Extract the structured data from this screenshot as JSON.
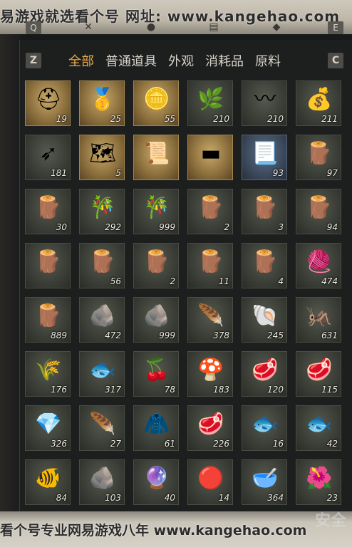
{
  "header": {
    "banner": "易游戏就选看个号   网址: www.kangehao.com",
    "keys_top": [
      "Q",
      "E"
    ],
    "icons_top": [
      "✕",
      "●",
      "▤",
      "◆"
    ]
  },
  "filters": {
    "prev_key": "Z",
    "next_key": "C",
    "tabs": [
      {
        "label": "全部",
        "active": true
      },
      {
        "label": "普通道具",
        "active": false
      },
      {
        "label": "外观",
        "active": false
      },
      {
        "label": "消耗品",
        "active": false
      },
      {
        "label": "原料",
        "active": false
      }
    ]
  },
  "items": [
    {
      "icon": "bronze-helmet-icon",
      "glyph": "⛑",
      "qty": "19",
      "style": "gold"
    },
    {
      "icon": "gold-ingot-icon",
      "glyph": "🥇",
      "qty": "25",
      "style": "gold"
    },
    {
      "icon": "cat-coin-icon",
      "glyph": "🪙",
      "qty": "55",
      "style": "gold"
    },
    {
      "icon": "herb-powder-icon",
      "glyph": "🌿",
      "qty": "210",
      "style": ""
    },
    {
      "icon": "worm-icon",
      "glyph": "〰",
      "qty": "210",
      "style": ""
    },
    {
      "icon": "cloth-sack-icon",
      "glyph": "💰",
      "qty": "211",
      "style": ""
    },
    {
      "icon": "arrows-icon",
      "glyph": "➶",
      "qty": "181",
      "style": ""
    },
    {
      "icon": "map-fragment-icon",
      "glyph": "🗺",
      "qty": "5",
      "style": "gold"
    },
    {
      "icon": "scroll-icon",
      "glyph": "📜",
      "qty": "",
      "style": "gold"
    },
    {
      "icon": "gold-bar-icon",
      "glyph": "▬",
      "qty": "",
      "style": "gold"
    },
    {
      "icon": "parchment-icon",
      "glyph": "📃",
      "qty": "93",
      "style": "blue"
    },
    {
      "icon": "log-bundle-icon",
      "glyph": "🪵",
      "qty": "97",
      "style": ""
    },
    {
      "icon": "log-bundle-icon",
      "glyph": "🪵",
      "qty": "30",
      "style": ""
    },
    {
      "icon": "bamboo-bundle-icon",
      "glyph": "🎋",
      "qty": "292",
      "style": ""
    },
    {
      "icon": "bamboo-bundle-icon",
      "glyph": "🎋",
      "qty": "999",
      "style": ""
    },
    {
      "icon": "log-bundle-icon",
      "glyph": "🪵",
      "qty": "2",
      "style": ""
    },
    {
      "icon": "log-bundle-icon",
      "glyph": "🪵",
      "qty": "3",
      "style": ""
    },
    {
      "icon": "log-bundle-icon",
      "glyph": "🪵",
      "qty": "94",
      "style": ""
    },
    {
      "icon": "log-bundle-icon",
      "glyph": "🪵",
      "qty": "",
      "style": ""
    },
    {
      "icon": "log-bundle-icon",
      "glyph": "🪵",
      "qty": "56",
      "style": ""
    },
    {
      "icon": "log-bundle-icon",
      "glyph": "🪵",
      "qty": "2",
      "style": ""
    },
    {
      "icon": "log-bundle-icon",
      "glyph": "🪵",
      "qty": "11",
      "style": ""
    },
    {
      "icon": "log-bundle-icon",
      "glyph": "🪵",
      "qty": "4",
      "style": ""
    },
    {
      "icon": "fiber-bundle-icon",
      "glyph": "🧶",
      "qty": "474",
      "style": ""
    },
    {
      "icon": "log-bundle-icon",
      "glyph": "🪵",
      "qty": "889",
      "style": ""
    },
    {
      "icon": "rock-icon",
      "glyph": "🪨",
      "qty": "472",
      "style": ""
    },
    {
      "icon": "rock-icon",
      "glyph": "🪨",
      "qty": "999",
      "style": ""
    },
    {
      "icon": "feather-icon",
      "glyph": "🪶",
      "qty": "378",
      "style": ""
    },
    {
      "icon": "shells-icon",
      "glyph": "🐚",
      "qty": "245",
      "style": ""
    },
    {
      "icon": "insect-icon",
      "glyph": "🦗",
      "qty": "631",
      "style": ""
    },
    {
      "icon": "grain-sack-icon",
      "glyph": "🌾",
      "qty": "176",
      "style": ""
    },
    {
      "icon": "fish-icon",
      "glyph": "🐟",
      "qty": "317",
      "style": ""
    },
    {
      "icon": "berries-icon",
      "glyph": "🍒",
      "qty": "78",
      "style": ""
    },
    {
      "icon": "mushroom-icon",
      "glyph": "🍄",
      "qty": "183",
      "style": ""
    },
    {
      "icon": "meat-chunks-icon",
      "glyph": "🥩",
      "qty": "120",
      "style": ""
    },
    {
      "icon": "meat-slab-icon",
      "glyph": "🥩",
      "qty": "115",
      "style": ""
    },
    {
      "icon": "jade-stone-icon",
      "glyph": "💎",
      "qty": "326",
      "style": ""
    },
    {
      "icon": "feathers-icon",
      "glyph": "🪶",
      "qty": "27",
      "style": ""
    },
    {
      "icon": "fur-pelt-icon",
      "glyph": "🧥",
      "qty": "61",
      "style": ""
    },
    {
      "icon": "red-meat-icon",
      "glyph": "🥩",
      "qty": "226",
      "style": ""
    },
    {
      "icon": "carp-fish-icon",
      "glyph": "🐟",
      "qty": "16",
      "style": ""
    },
    {
      "icon": "salmon-fish-icon",
      "glyph": "🐟",
      "qty": "42",
      "style": ""
    },
    {
      "icon": "golden-fish-icon",
      "glyph": "🐠",
      "qty": "84",
      "style": ""
    },
    {
      "icon": "ore-icon",
      "glyph": "🪨",
      "qty": "103",
      "style": ""
    },
    {
      "icon": "amethyst-icon",
      "glyph": "🔮",
      "qty": "40",
      "style": ""
    },
    {
      "icon": "red-gem-icon",
      "glyph": "🔴",
      "qty": "14",
      "style": ""
    },
    {
      "icon": "spice-bowl-icon",
      "glyph": "🥣",
      "qty": "364",
      "style": ""
    },
    {
      "icon": "flower-icon",
      "glyph": "🌺",
      "qty": "23",
      "style": ""
    }
  ],
  "footer": {
    "banner": "看个号专业网易游戏八年   www.kangehao.com",
    "watermark": "安全"
  }
}
